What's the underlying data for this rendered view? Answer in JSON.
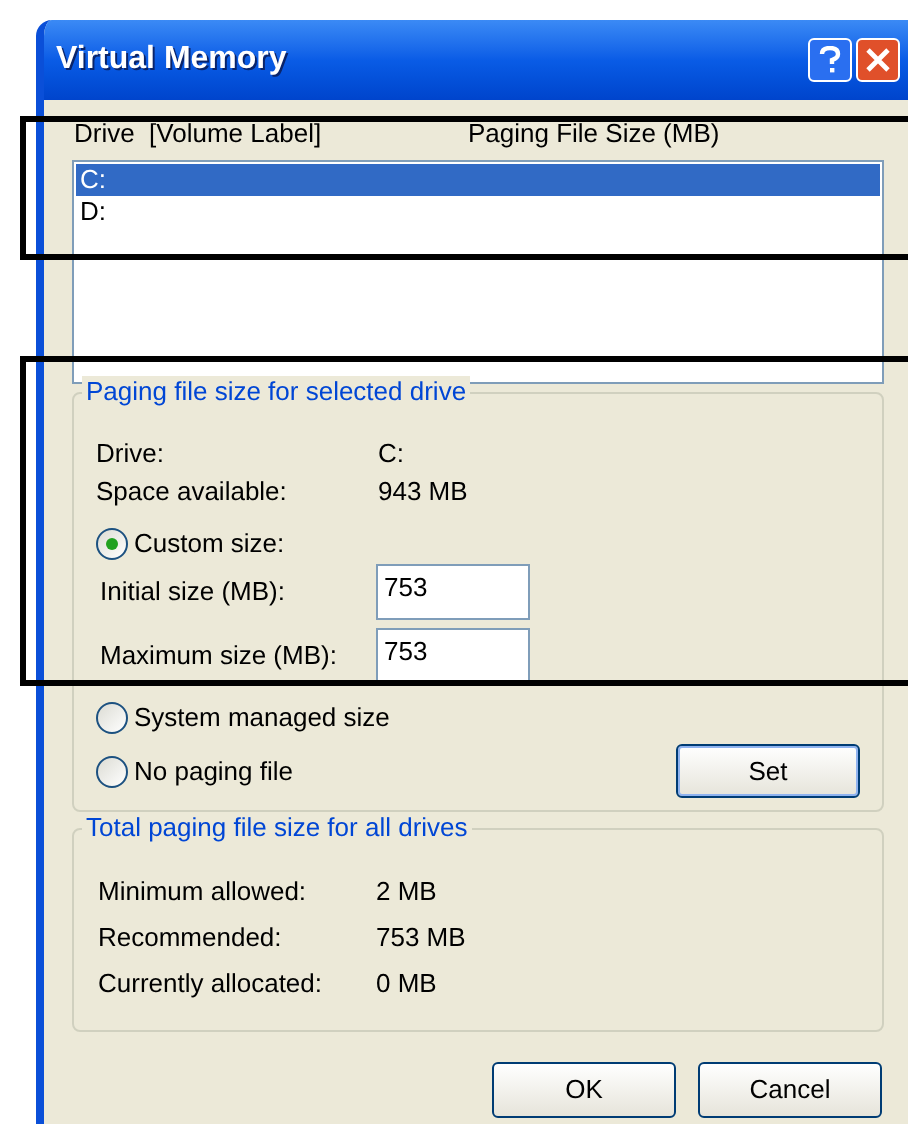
{
  "window": {
    "title": "Virtual Memory"
  },
  "drive_list": {
    "columns": [
      "Drive  [Volume Label]",
      "Paging File Size (MB)"
    ],
    "rows": [
      {
        "drive": "C:",
        "selected": true
      },
      {
        "drive": "D:",
        "selected": false
      }
    ]
  },
  "selected_drive_group": {
    "title": "Paging file size for selected drive",
    "info": [
      {
        "label": "Drive:",
        "value": "C:"
      },
      {
        "label": "Space available:",
        "value": "943 MB"
      }
    ],
    "custom_option": {
      "label": "Custom size:",
      "selected": true
    },
    "fields": [
      {
        "label": "Initial size (MB):",
        "value": "753"
      },
      {
        "label": "Maximum size (MB):",
        "value": "753"
      }
    ],
    "other_options": [
      {
        "label": "System managed size",
        "selected": false
      },
      {
        "label": "No paging file",
        "selected": false
      }
    ],
    "set_button": "Set"
  },
  "total_group": {
    "title": "Total paging file size for all drives",
    "rows": [
      {
        "label": "Minimum allowed:",
        "value": "2 MB"
      },
      {
        "label": "Recommended:",
        "value": "753 MB"
      },
      {
        "label": "Currently allocated:",
        "value": "0 MB"
      }
    ]
  },
  "buttons": [
    "OK",
    "Cancel"
  ]
}
